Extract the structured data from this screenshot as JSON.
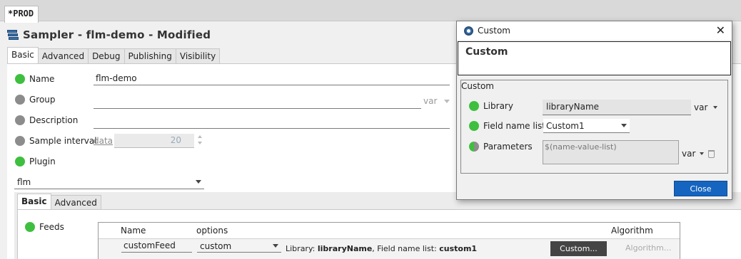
{
  "top_tab": "*PROD",
  "title": "Sampler - flm-demo - Modified",
  "main_tabs": [
    "Basic",
    "Advanced",
    "Debug",
    "Publishing",
    "Visibility"
  ],
  "fields": {
    "name_label": "Name",
    "name_value": "flm-demo",
    "group_label": "Group",
    "group_var": "var",
    "description_label": "Description",
    "interval_label": "Sample interval",
    "interval_data": "data",
    "interval_value": "20",
    "plugin_label": "Plugin",
    "plugin_value": "flm"
  },
  "sub_tabs": [
    "Basic",
    "Advanced"
  ],
  "feeds": {
    "label": "Feeds",
    "headers": {
      "name": "Name",
      "options": "options",
      "algorithm": "Algorithm"
    },
    "row": {
      "name": "customFeed",
      "option": "custom",
      "info_prefix_1": "Library: ",
      "info_value_1": "libraryName",
      "info_prefix_2": ", Field name list: ",
      "info_value_2": "custom1",
      "custom_button": "Custom...",
      "algorithm_button": "Algorithm..."
    }
  },
  "dialog": {
    "title": "Custom",
    "header": "Custom",
    "group_title": "Custom",
    "library_label": "Library",
    "library_value": "libraryName",
    "library_var": "var",
    "field_list_label": "Field name list",
    "field_list_value": "Custom1",
    "parameters_label": "Parameters",
    "parameters_placeholder": "$(name-value-list)",
    "parameters_var": "var",
    "close_button": "Close"
  }
}
